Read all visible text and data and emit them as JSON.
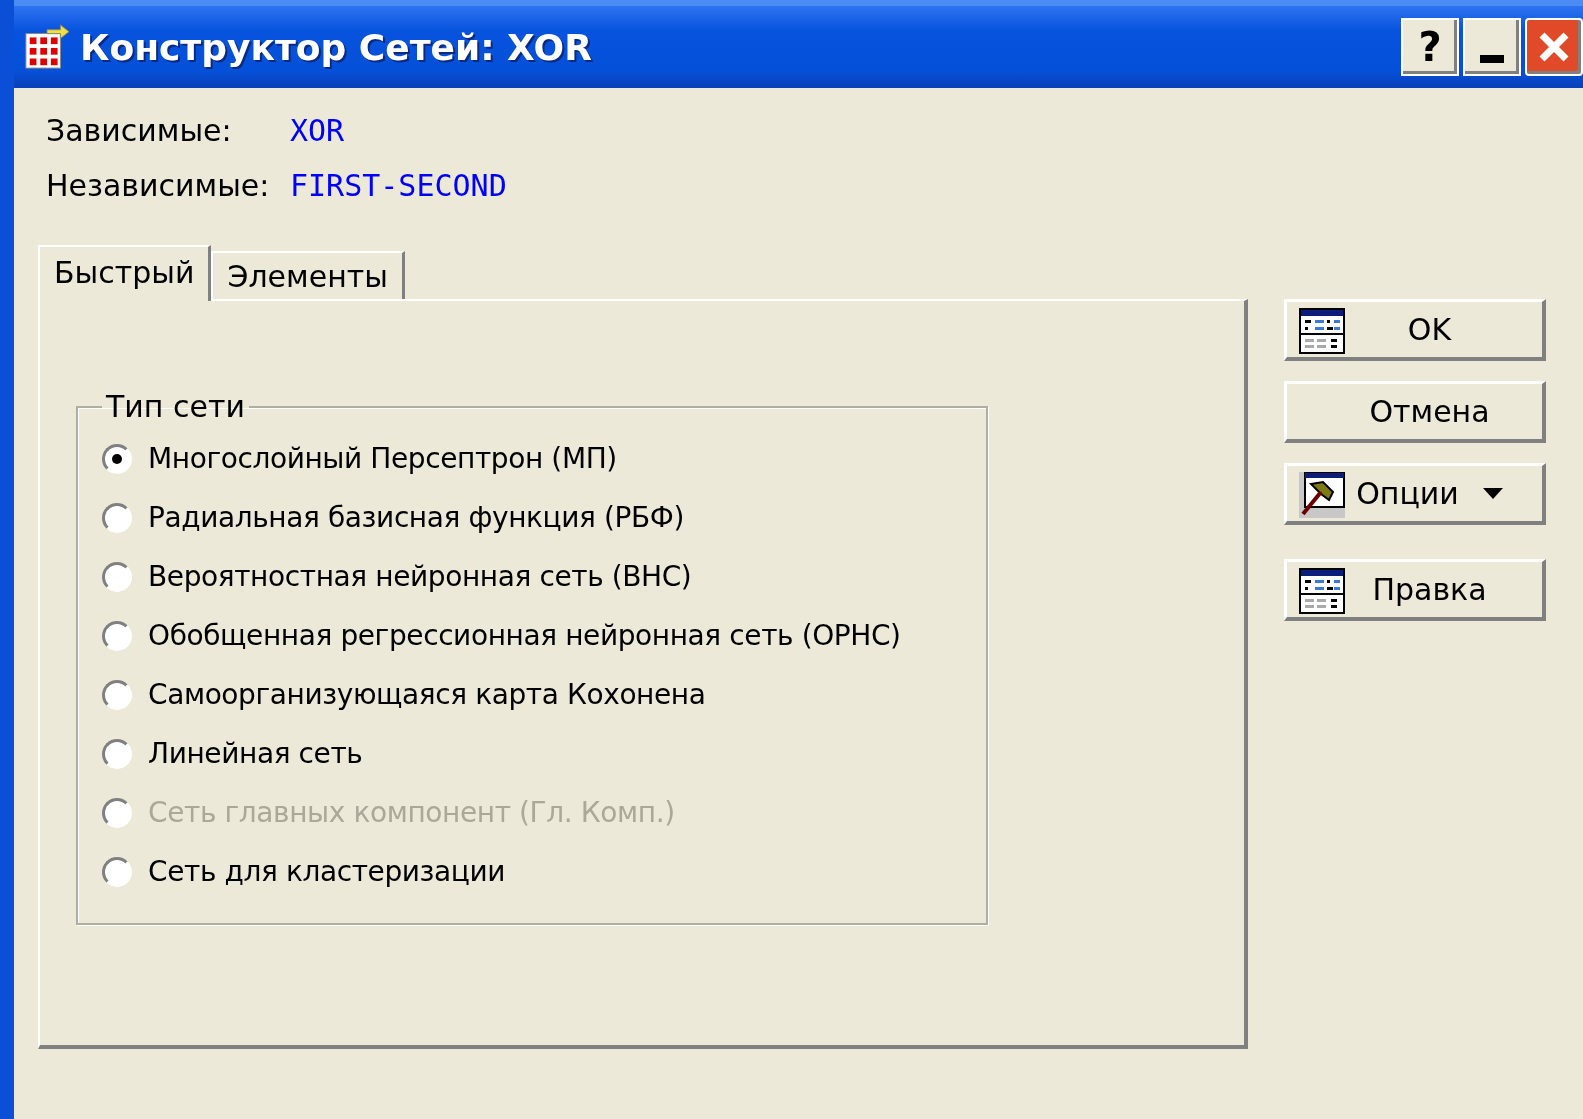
{
  "window": {
    "title": "Конструктор Сетей: XOR",
    "help_button": "?"
  },
  "fields": [
    {
      "label": "Зависимые:",
      "value": "XOR"
    },
    {
      "label": "Независимые:",
      "value": "FIRST-SECOND"
    }
  ],
  "tabs": [
    {
      "label": "Быстрый",
      "selected": true
    },
    {
      "label": "Элементы",
      "selected": false
    }
  ],
  "network_type": {
    "title": "Тип сети",
    "options": [
      {
        "label": "Многослойный Персептрон (МП)",
        "selected": true,
        "disabled": false
      },
      {
        "label": "Радиальная базисная функция (РБФ)",
        "selected": false,
        "disabled": false
      },
      {
        "label": "Вероятностная нейронная сеть (ВНС)",
        "selected": false,
        "disabled": false
      },
      {
        "label": "Обобщенная регрессионная нейронная сеть (ОРНС)",
        "selected": false,
        "disabled": false
      },
      {
        "label": "Самоорганизующаяся карта Кохонена",
        "selected": false,
        "disabled": false
      },
      {
        "label": "Линейная сеть",
        "selected": false,
        "disabled": false
      },
      {
        "label": "Сеть главных компонент (Гл. Комп.)",
        "selected": false,
        "disabled": true
      },
      {
        "label": "Сеть для кластеризации",
        "selected": false,
        "disabled": false
      }
    ]
  },
  "buttons": [
    {
      "label": "OK",
      "kind": "table"
    },
    {
      "label": "Отмена",
      "kind": "plain"
    },
    {
      "label": "Опции",
      "kind": "menu"
    },
    {
      "label": "Правка",
      "kind": "table"
    }
  ]
}
